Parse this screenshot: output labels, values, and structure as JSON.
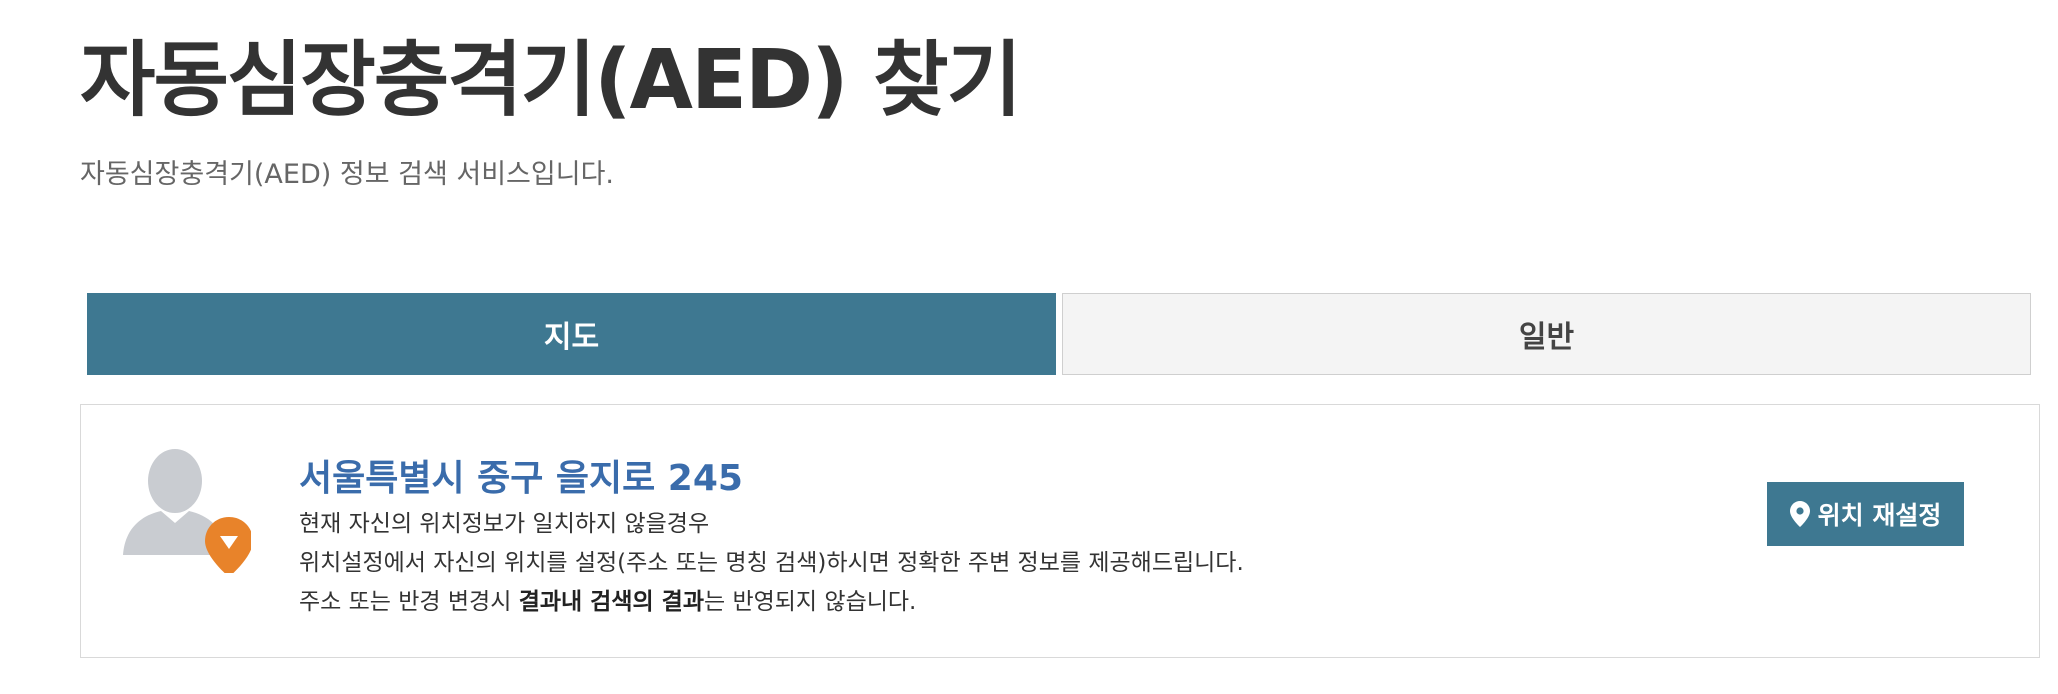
{
  "page": {
    "title": "자동심장충격기(AED) 찾기",
    "subtitle": "자동심장충격기(AED) 정보 검색 서비스입니다."
  },
  "tabs": [
    {
      "label": "지도",
      "active": true
    },
    {
      "label": "일반",
      "active": false
    }
  ],
  "location": {
    "avatar_icon": "user-location-icon",
    "address": "서울특별시 중구 을지로 245",
    "line1": "현재 자신의 위치정보가 일치하지 않을경우",
    "line2": "위치설정에서 자신의 위치를 설정(주소 또는 명칭 검색)하시면 정확한 주변 정보를 제공해드립니다.",
    "line3_prefix": "주소 또는 반경 변경시 ",
    "line3_bold": "결과내 검색의 결과",
    "line3_suffix": "는 반영되지 않습니다.",
    "reset_button_label": "위치 재설정",
    "reset_button_icon": "map-pin-icon"
  },
  "colors": {
    "accent": "#3e7891",
    "address": "#3a6cab",
    "pin_orange": "#e8832a",
    "avatar_gray": "#c9ccd1"
  }
}
